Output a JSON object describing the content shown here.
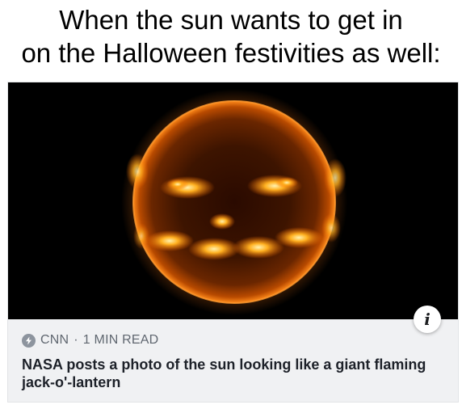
{
  "meme": {
    "caption_line1": "When the sun wants to get in",
    "caption_line2": "on the Halloween festivities as well:"
  },
  "link_preview": {
    "image_icon": "sun-jack-o-lantern-photo",
    "info_icon": "info-icon",
    "info_glyph": "i",
    "source_icon": "lightning-bolt-icon",
    "source": "CNN",
    "separator": "·",
    "read_time": "1 MIN READ",
    "headline": "NASA posts a photo of the sun looking like a giant flaming jack-o'-lantern"
  },
  "colors": {
    "card_background": "#f0f1f3",
    "meta_text": "#606770",
    "headline_text": "#1d2129",
    "sun_core": "#3a1200",
    "sun_glow": "#ff8a1a"
  }
}
